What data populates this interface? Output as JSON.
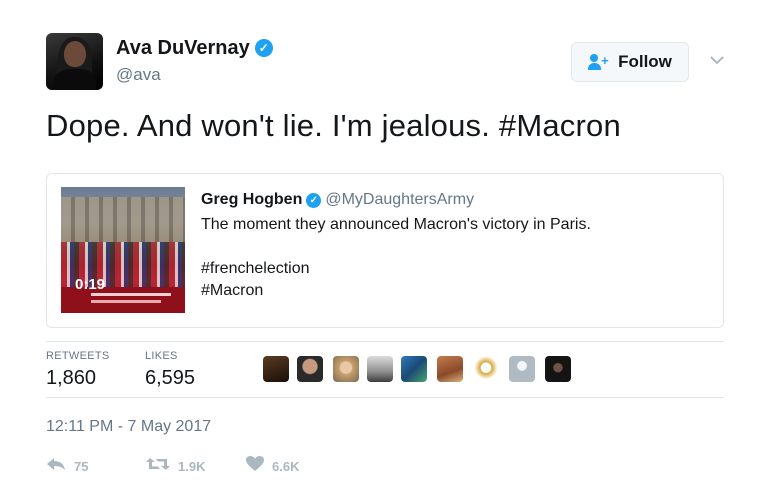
{
  "author": {
    "name": "Ava DuVernay",
    "handle": "@ava",
    "verified_mark": "✓"
  },
  "follow_button": {
    "label": "Follow",
    "icon": "person-add-icon"
  },
  "menu_icon": "chevron-down-icon",
  "tweet": {
    "text": "Dope. And won't lie. I'm jealous. #Macron"
  },
  "quoted_tweet": {
    "author_name": "Greg Hogben",
    "author_handle": "@MyDaughtersArmy",
    "verified_mark": "✓",
    "text_line": "The moment they announced Macron's victory in Paris.",
    "hashtags": [
      "#frenchelection",
      "#Macron"
    ],
    "video_duration": "0:19"
  },
  "stats": {
    "retweets_label": "RETWEETS",
    "retweets_value": "1,860",
    "likes_label": "LIKES",
    "likes_value": "6,595",
    "likers": [
      "liker-1",
      "liker-2",
      "liker-3",
      "liker-4",
      "liker-5",
      "liker-6",
      "liker-7",
      "liker-8",
      "liker-9"
    ]
  },
  "timestamp": "12:11 PM - 7 May 2017",
  "actions": {
    "reply_count": "75",
    "retweet_count": "1.9K",
    "like_count": "6.6K"
  },
  "colors": {
    "accent": "#1da1f2",
    "text": "#14171a",
    "muted": "#657786",
    "action_gray": "#aab8c2",
    "border": "#e1e8ed"
  }
}
